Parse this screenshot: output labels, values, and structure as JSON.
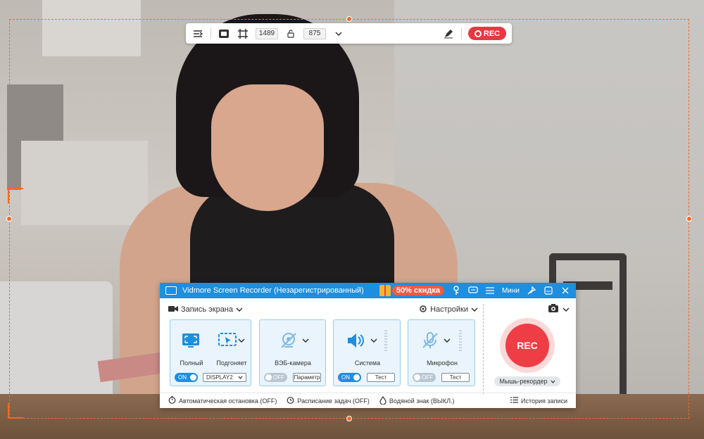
{
  "toolbar": {
    "width": "1489",
    "height": "875",
    "rec_label": "REC"
  },
  "app": {
    "title": "Vidmore Screen Recorder (Незарегистрированный)",
    "promo_label": "50% скидка",
    "mini_label": "Мини",
    "mode_label": "Запись экрана",
    "settings_label": "Настройки",
    "cards": {
      "full_label": "Полный",
      "fit_label": "Подгоняет",
      "display_toggle": "ON",
      "display_select": "DISPLAY2",
      "webcam_label": "ВЭБ-камера",
      "webcam_toggle": "OFF",
      "webcam_params": "Параметр",
      "system_label": "Система",
      "system_toggle": "ON",
      "system_test": "Тест",
      "mic_label": "Микрофон",
      "mic_toggle": "OFF",
      "mic_test": "Тест"
    },
    "rec_label": "REC",
    "mouse_recorder_label": "Мышь-рекордер",
    "footer": {
      "auto_stop": "Автоматическая остановка (OFF)",
      "schedule": "Расписание задач (OFF)",
      "watermark": "Водяной знак (ВЫКЛ.)",
      "history": "История записи"
    }
  },
  "colors": {
    "accent": "#1e8ee0",
    "rec": "#ee3d45",
    "region": "#f06a2c"
  }
}
